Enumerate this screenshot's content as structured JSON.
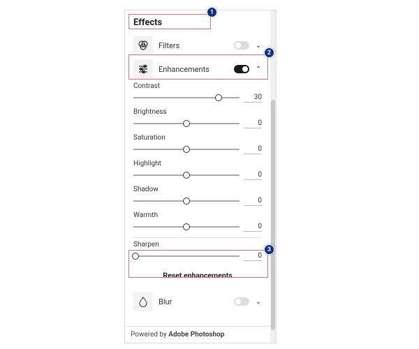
{
  "section_title": "Effects",
  "filters": {
    "label": "Filters",
    "enabled": false
  },
  "enhancements": {
    "label": "Enhancements",
    "enabled": true,
    "reset_label": "Reset enhancements",
    "sliders": {
      "contrast": {
        "label": "Contrast",
        "value": 30,
        "pos": 0.8
      },
      "brightness": {
        "label": "Brightness",
        "value": 0,
        "pos": 0.5
      },
      "saturation": {
        "label": "Saturation",
        "value": 0,
        "pos": 0.5
      },
      "highlight": {
        "label": "Highlight",
        "value": 0,
        "pos": 0.5
      },
      "shadow": {
        "label": "Shadow",
        "value": 0,
        "pos": 0.5
      },
      "warmth": {
        "label": "Warmth",
        "value": 0,
        "pos": 0.5
      },
      "sharpen": {
        "label": "Sharpen",
        "value": 0,
        "pos": 0.02
      }
    }
  },
  "blur": {
    "label": "Blur",
    "enabled": false
  },
  "footer": {
    "prefix": "Powered by ",
    "brand": "Adobe Photoshop"
  },
  "annotations": {
    "n1": "1",
    "n2": "2",
    "n3": "3"
  }
}
